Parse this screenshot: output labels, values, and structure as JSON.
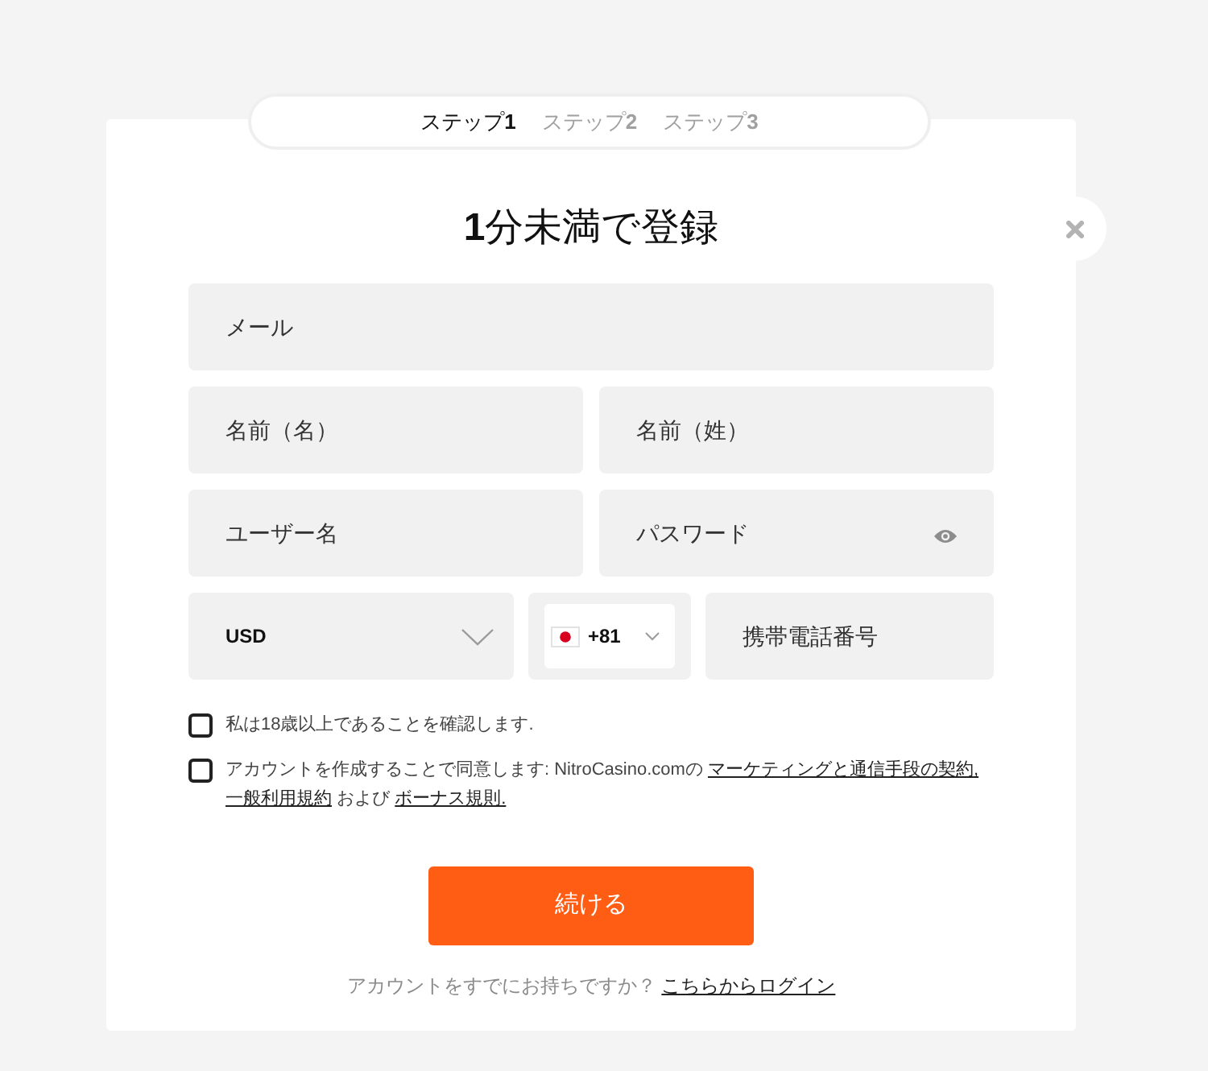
{
  "steps": [
    {
      "label": "ステップ**1**",
      "selected": true
    },
    {
      "label": "ステップ**2**",
      "selected": false
    },
    {
      "label": "ステップ**3**",
      "selected": false
    }
  ],
  "title": "**1**分未満で登録",
  "field_rows": [
    [
      {
        "kind": "email",
        "placeholder": "メール"
      }
    ],
    [
      {
        "kind": "text",
        "placeholder": "名前（名）"
      },
      {
        "kind": "text",
        "placeholder": "名前（姓）"
      }
    ],
    [
      {
        "kind": "text",
        "placeholder": "ユーザー名"
      },
      {
        "kind": "password",
        "placeholder": "パスワード"
      }
    ],
    [
      {
        "kind": "currency",
        "value": "USD"
      },
      {
        "kind": "phone_code",
        "value": "+81"
      },
      {
        "kind": "tel",
        "placeholder": "携帯電話番号"
      }
    ]
  ],
  "checkboxes": [
    {
      "checked": false,
      "parts": [
        {
          "kind": "text",
          "text": "私は18歳以上であることを確認します."
        }
      ]
    },
    {
      "checked": false,
      "parts": [
        {
          "kind": "text",
          "text": "アカウントを作成することで同意します: NitroCasino.comの "
        },
        {
          "kind": "link",
          "text": "マーケティングと通信手段の契約,"
        },
        {
          "kind": "link",
          "text": "一般利用規約"
        },
        {
          "kind": "text",
          "text": " および "
        },
        {
          "kind": "link",
          "text": "ボーナス規則."
        }
      ]
    }
  ],
  "submit_button": "続ける",
  "login_prompt": {
    "text": "アカウントをすでにお持ちですか？",
    "link": "こちらからログイン"
  }
}
